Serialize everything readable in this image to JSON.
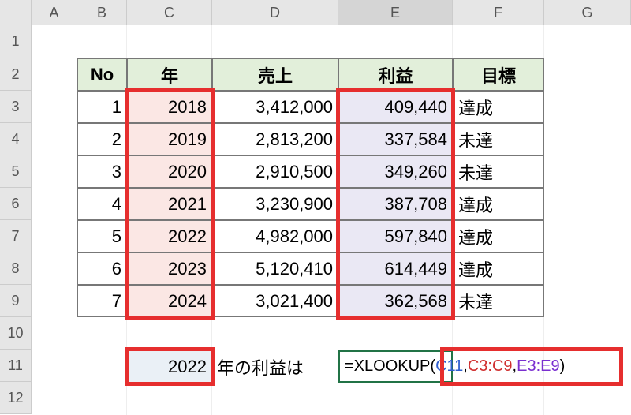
{
  "columns": [
    "A",
    "B",
    "C",
    "D",
    "E",
    "F",
    "G"
  ],
  "active_column": "E",
  "rows": [
    "1",
    "2",
    "3",
    "4",
    "5",
    "6",
    "7",
    "8",
    "9",
    "10",
    "11",
    "12"
  ],
  "table": {
    "headers": {
      "no": "No",
      "year": "年",
      "sales": "売上",
      "profit": "利益",
      "target": "目標"
    },
    "rows": [
      {
        "no": "1",
        "year": "2018",
        "sales": "3,412,000",
        "profit": "409,440",
        "target": "達成"
      },
      {
        "no": "2",
        "year": "2019",
        "sales": "2,813,200",
        "profit": "337,584",
        "target": "未達"
      },
      {
        "no": "3",
        "year": "2020",
        "sales": "2,910,500",
        "profit": "349,260",
        "target": "未達"
      },
      {
        "no": "4",
        "year": "2021",
        "sales": "3,230,900",
        "profit": "387,708",
        "target": "達成"
      },
      {
        "no": "5",
        "year": "2022",
        "sales": "4,982,000",
        "profit": "597,840",
        "target": "達成"
      },
      {
        "no": "6",
        "year": "2023",
        "sales": "5,120,410",
        "profit": "614,449",
        "target": "達成"
      },
      {
        "no": "7",
        "year": "2024",
        "sales": "3,021,400",
        "profit": "362,568",
        "target": "未達"
      }
    ]
  },
  "row11": {
    "c11_value": "2022",
    "d11_label": "年の利益は",
    "formula_prefix": "=XLOOKUP",
    "formula_open": "(",
    "arg1": "C11",
    "sep": ",",
    "arg2": "C3:C9",
    "arg3": "E3:E9",
    "formula_close": ")"
  },
  "chart_data": {
    "type": "table",
    "title": "",
    "columns": [
      "No",
      "年",
      "売上",
      "利益",
      "目標"
    ],
    "rows": [
      [
        1,
        2018,
        3412000,
        409440,
        "達成"
      ],
      [
        2,
        2019,
        2813200,
        337584,
        "未達"
      ],
      [
        3,
        2020,
        2910500,
        349260,
        "未達"
      ],
      [
        4,
        2021,
        3230900,
        387708,
        "達成"
      ],
      [
        5,
        2022,
        4982000,
        597840,
        "達成"
      ],
      [
        6,
        2023,
        5120410,
        614449,
        "達成"
      ],
      [
        7,
        2024,
        3021400,
        362568,
        "未達"
      ]
    ],
    "lookup": {
      "year": 2022,
      "formula": "=XLOOKUP(C11,C3:C9,E3:E9)"
    }
  }
}
